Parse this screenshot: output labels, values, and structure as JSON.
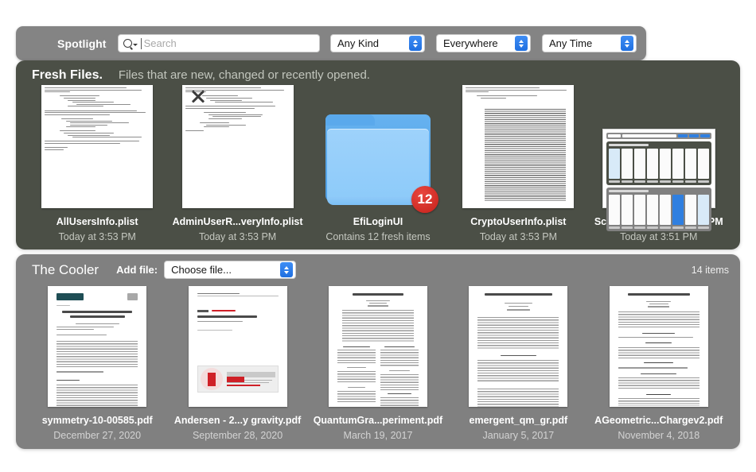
{
  "search": {
    "label": "Spotlight",
    "placeholder": "Search",
    "value": "",
    "icon": "search-icon",
    "filters": [
      {
        "name": "kind-filter",
        "value": "Any Kind"
      },
      {
        "name": "scope-filter",
        "value": "Everywhere"
      },
      {
        "name": "time-filter",
        "value": "Any Time"
      }
    ]
  },
  "fresh": {
    "title": "Fresh Files.",
    "subtitle": "Files that are new, changed or recently opened.",
    "items": [
      {
        "name": "AllUsersInfo.plist",
        "meta": "Today at 3:53 PM",
        "kind": "plist"
      },
      {
        "name": "AdminUserR...veryInfo.plist",
        "meta": "Today at 3:53 PM",
        "kind": "plist-cursor"
      },
      {
        "name": "EfiLoginUI",
        "meta": "Contains 12 fresh items",
        "kind": "folder",
        "badge": "12"
      },
      {
        "name": "CryptoUserInfo.plist",
        "meta": "Today at 3:53 PM",
        "kind": "plist-dense"
      },
      {
        "name": "Screen Shot...at 3.49.17 PM",
        "meta": "Today at 3:51 PM",
        "kind": "screenshot"
      }
    ]
  },
  "cooler": {
    "title": "The Cooler",
    "add_file_label": "Add file:",
    "chooser_value": "Choose file...",
    "count": "14 items",
    "items": [
      {
        "name": "symmetry-10-00585.pdf",
        "meta": "December 27, 2020",
        "kind": "paper-mdpi"
      },
      {
        "name": "Andersen - 2...y gravity.pdf",
        "meta": "September 28, 2020",
        "kind": "paper-iop"
      },
      {
        "name": "QuantumGra...periment.pdf",
        "meta": "March 19, 2017",
        "kind": "paper-twocol"
      },
      {
        "name": "emergent_qm_gr.pdf",
        "meta": "January 5, 2017",
        "kind": "paper-onecol"
      },
      {
        "name": "AGeometric...Chargev2.pdf",
        "meta": "November 4, 2018",
        "kind": "paper-eqn"
      }
    ]
  },
  "colors": {
    "page_background": "#ffffff",
    "search_bar": "#848484",
    "fresh_panel": "#4b4f46",
    "cooler_panel": "#808080",
    "accent_blue": "#2f7fe0",
    "badge_red": "#c6201a",
    "folder_blue": "#8ccaf9"
  }
}
